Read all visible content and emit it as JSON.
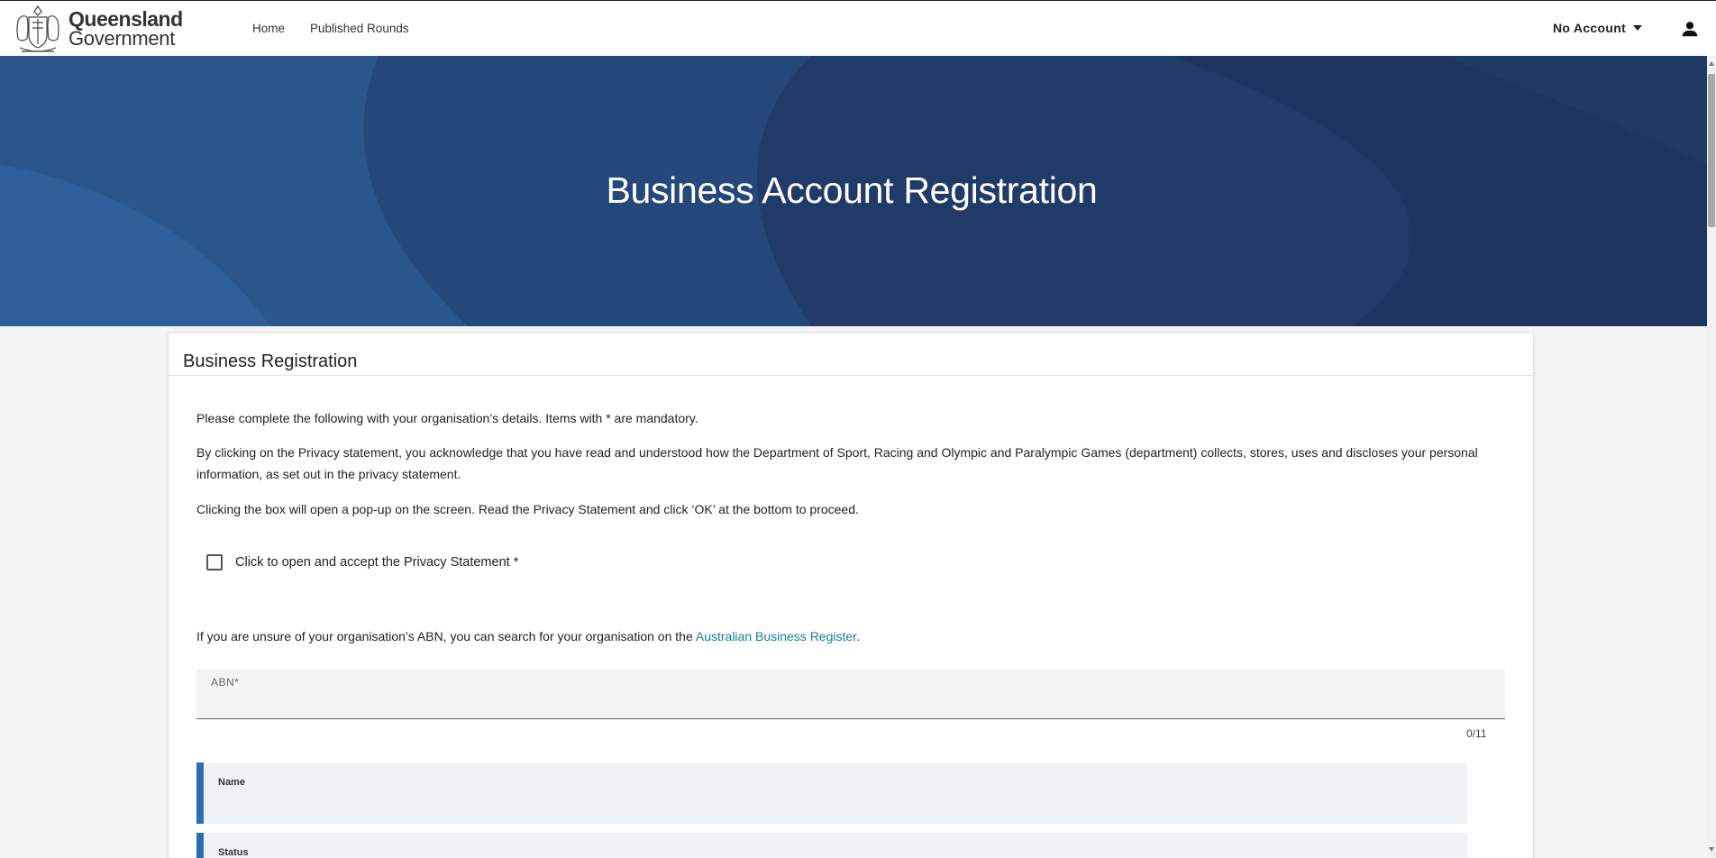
{
  "header": {
    "logo_line1": "Queensland",
    "logo_line2": "Government",
    "nav": [
      {
        "label": "Home"
      },
      {
        "label": "Published Rounds"
      }
    ],
    "account_label": "No Account"
  },
  "hero": {
    "title": "Business Account Registration"
  },
  "form": {
    "title": "Business Registration",
    "intro": "Please complete the following with your organisation’s details. Items with * are mandatory.",
    "privacy_note": "By clicking on the Privacy statement, you acknowledge that you have read and understood how the Department of Sport, Racing and Olympic and Paralympic Games (department) collects, stores, uses and discloses your personal information, as set out in the privacy statement.",
    "popup_note": "Clicking the box will open a pop-up on the screen. Read the Privacy Statement and click ‘OK’ at the bottom to proceed.",
    "privacy_checkbox_label": "Click to open and accept the Privacy Statement *",
    "abn_hint_prefix": "If you are unsure of your organisation’s ABN, you can search for your organisation on the ",
    "abn_hint_link": "Australian Business Register",
    "abn_hint_suffix": ".",
    "abn_label": "ABN*",
    "abn_value": "",
    "abn_counter": "0/11",
    "name_label": "Name",
    "status_label": "Status"
  },
  "colors": {
    "hero_bg": "#1e3a66",
    "accent": "#2c6fb0",
    "link": "#1a7a9a"
  }
}
